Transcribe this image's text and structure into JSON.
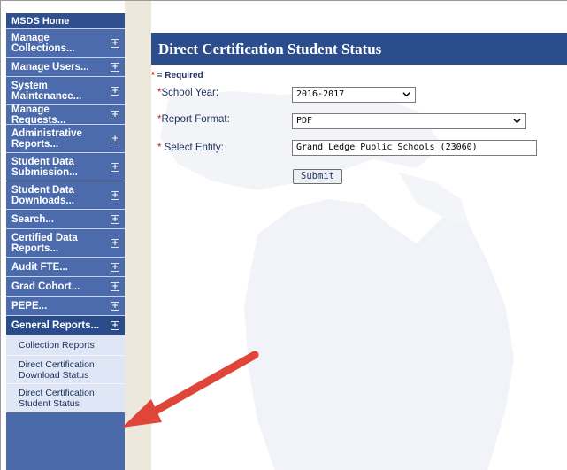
{
  "sidebar": {
    "header": "MSDS Home",
    "items": [
      {
        "label": "Manage Collections..."
      },
      {
        "label": "Manage Users..."
      },
      {
        "label": "System Maintenance..."
      },
      {
        "label": "Manage Requests..."
      },
      {
        "label": "Administrative Reports..."
      },
      {
        "label": "Student Data Submission..."
      },
      {
        "label": "Student Data Downloads..."
      },
      {
        "label": "Search..."
      },
      {
        "label": "Certified Data Reports..."
      },
      {
        "label": "Audit FTE..."
      },
      {
        "label": "Grad Cohort..."
      },
      {
        "label": "PEPE..."
      },
      {
        "label": "General Reports..."
      }
    ],
    "expand_symbol": "⊞",
    "sub_items": [
      {
        "label": "Collection Reports"
      },
      {
        "label": "Direct Certification Download Status"
      },
      {
        "label": "Direct Certification Student Status"
      }
    ]
  },
  "page": {
    "title": "Direct Certification Student Status",
    "required_marker": "*",
    "required_note": " = Required"
  },
  "form": {
    "school_year": {
      "marker": "*",
      "label": "School Year:",
      "value": "2016-2017"
    },
    "report_format": {
      "marker": "*",
      "label": "Report Format:",
      "value": "PDF"
    },
    "entity": {
      "marker": "* ",
      "label": "Select Entity:",
      "value": "Grand Ledge Public Schools (23060)"
    },
    "submit_label": "Submit"
  },
  "colors": {
    "sidebar_blue": "#4b6bac",
    "title_bar": "#2c4d8c",
    "required_red": "#d0201a",
    "annotation_arrow": "#e0453a"
  }
}
